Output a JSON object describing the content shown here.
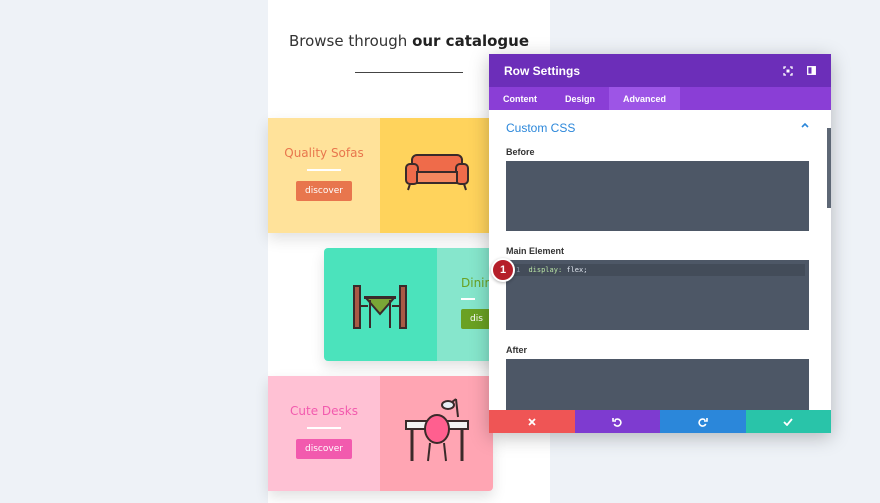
{
  "catalogue": {
    "heading_light": "Browse through",
    "heading_bold": "our catalogue",
    "cards": [
      {
        "title": "Quality Sofas",
        "button": "discover",
        "icon": "sofa-icon"
      },
      {
        "title": "Dinin",
        "button": "dis",
        "icon": "dining-table-icon"
      },
      {
        "title": "Cute Desks",
        "button": "discover",
        "icon": "desk-icon"
      }
    ]
  },
  "settings_panel": {
    "title": "Row Settings",
    "header_icons": [
      "expand-icon",
      "sidebar-toggle-icon"
    ],
    "tabs": [
      {
        "label": "Content",
        "active": false
      },
      {
        "label": "Design",
        "active": false
      },
      {
        "label": "Advanced",
        "active": true
      }
    ],
    "section_title": "Custom CSS",
    "fields": {
      "before_label": "Before",
      "main_label": "Main Element",
      "after_label": "After"
    },
    "code": {
      "line_number": "1",
      "property": "display:",
      "value": "flex;"
    },
    "footer_buttons": [
      {
        "icon": "close-icon",
        "color": "#ef5555"
      },
      {
        "icon": "undo-icon",
        "color": "#7e3bd0"
      },
      {
        "icon": "redo-icon",
        "color": "#2b87da"
      },
      {
        "icon": "check-icon",
        "color": "#29c4a9"
      }
    ]
  },
  "step_badge": "1",
  "colors": {
    "purple_dark": "#6c2eb9",
    "purple": "#8a3ed6",
    "link_blue": "#2b87da",
    "code_bg": "#4d5766"
  }
}
